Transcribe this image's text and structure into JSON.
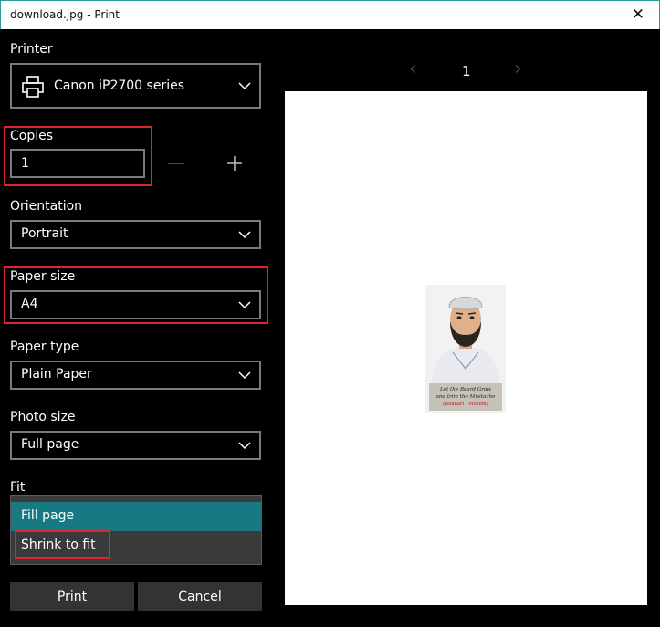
{
  "window": {
    "title": "download.jpg - Print",
    "close_glyph": "✕"
  },
  "printer": {
    "label": "Printer",
    "value": "Canon iP2700 series",
    "icon": "printer-icon"
  },
  "copies": {
    "label": "Copies",
    "value": "1"
  },
  "orientation": {
    "label": "Orientation",
    "value": "Portrait"
  },
  "paper_size": {
    "label": "Paper size",
    "value": "A4"
  },
  "paper_type": {
    "label": "Paper type",
    "value": "Plain Paper"
  },
  "photo_size": {
    "label": "Photo size",
    "value": "Full page"
  },
  "fit": {
    "label": "Fit",
    "options": [
      "Fill page",
      "Shrink to fit"
    ],
    "selected": "Fill page"
  },
  "buttons": {
    "print": "Print",
    "cancel": "Cancel"
  },
  "preview": {
    "page_number": "1",
    "prev_glyph": "‹",
    "next_glyph": "›",
    "caption_line1": "Let the Beard Grow",
    "caption_line2": "and trim the Mustache",
    "caption_line3": "[Bukhari - Muslim]"
  },
  "colors": {
    "highlight": "#e0242e",
    "selected_item": "#177a82",
    "accent": "#2a9aa0"
  }
}
